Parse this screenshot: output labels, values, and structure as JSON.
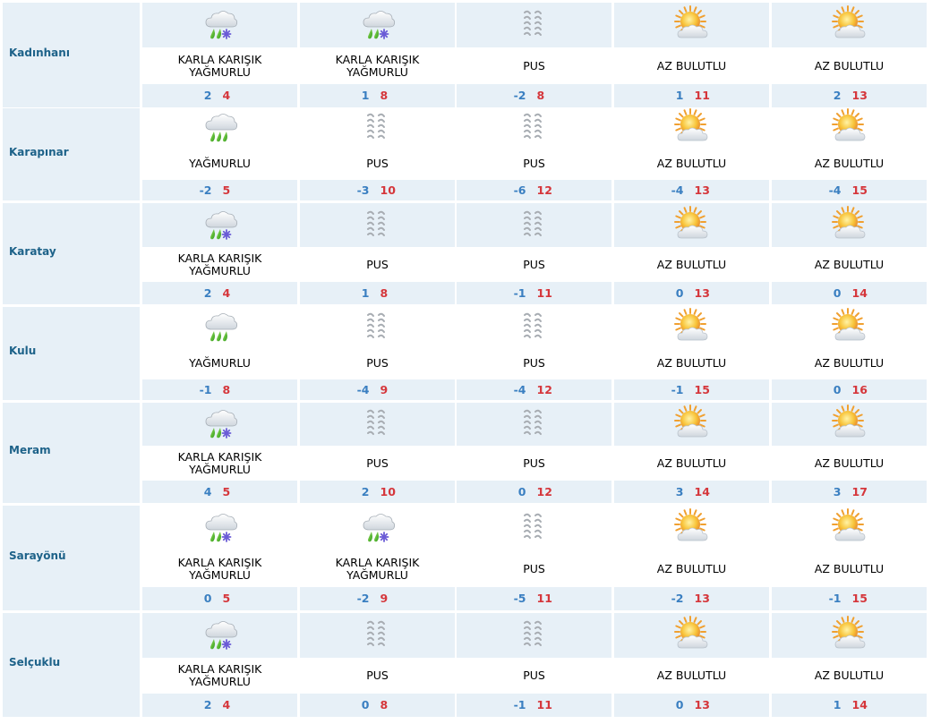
{
  "rows": [
    {
      "city": "Kadınhanı",
      "days": [
        {
          "icon": "sleet-icon",
          "desc": [
            "KARLA KARIŞIK",
            "YAĞMURLU"
          ],
          "min": "2",
          "max": "4"
        },
        {
          "icon": "sleet-icon",
          "desc": [
            "KARLA KARIŞIK",
            "YAĞMURLU"
          ],
          "min": "1",
          "max": "8"
        },
        {
          "icon": "fog-icon",
          "desc": [
            "PUS"
          ],
          "min": "-2",
          "max": "8"
        },
        {
          "icon": "partly-cloudy-icon",
          "desc": [
            "AZ BULUTLU"
          ],
          "min": "1",
          "max": "11"
        },
        {
          "icon": "partly-cloudy-icon",
          "desc": [
            "AZ BULUTLU"
          ],
          "min": "2",
          "max": "13"
        }
      ]
    },
    {
      "city": "Karapınar",
      "days": [
        {
          "icon": "rain-icon",
          "desc": [
            "YAĞMURLU"
          ],
          "min": "-2",
          "max": "5"
        },
        {
          "icon": "fog-icon",
          "desc": [
            "PUS"
          ],
          "min": "-3",
          "max": "10"
        },
        {
          "icon": "fog-icon",
          "desc": [
            "PUS"
          ],
          "min": "-6",
          "max": "12"
        },
        {
          "icon": "partly-cloudy-icon",
          "desc": [
            "AZ BULUTLU"
          ],
          "min": "-4",
          "max": "13"
        },
        {
          "icon": "partly-cloudy-icon",
          "desc": [
            "AZ BULUTLU"
          ],
          "min": "-4",
          "max": "15"
        }
      ]
    },
    {
      "city": "Karatay",
      "days": [
        {
          "icon": "sleet-icon",
          "desc": [
            "KARLA KARIŞIK",
            "YAĞMURLU"
          ],
          "min": "2",
          "max": "4"
        },
        {
          "icon": "fog-icon",
          "desc": [
            "PUS"
          ],
          "min": "1",
          "max": "8"
        },
        {
          "icon": "fog-icon",
          "desc": [
            "PUS"
          ],
          "min": "-1",
          "max": "11"
        },
        {
          "icon": "partly-cloudy-icon",
          "desc": [
            "AZ BULUTLU"
          ],
          "min": "0",
          "max": "13"
        },
        {
          "icon": "partly-cloudy-icon",
          "desc": [
            "AZ BULUTLU"
          ],
          "min": "0",
          "max": "14"
        }
      ]
    },
    {
      "city": "Kulu",
      "days": [
        {
          "icon": "rain-icon",
          "desc": [
            "YAĞMURLU"
          ],
          "min": "-1",
          "max": "8"
        },
        {
          "icon": "fog-icon",
          "desc": [
            "PUS"
          ],
          "min": "-4",
          "max": "9"
        },
        {
          "icon": "fog-icon",
          "desc": [
            "PUS"
          ],
          "min": "-4",
          "max": "12"
        },
        {
          "icon": "partly-cloudy-icon",
          "desc": [
            "AZ BULUTLU"
          ],
          "min": "-1",
          "max": "15"
        },
        {
          "icon": "partly-cloudy-icon",
          "desc": [
            "AZ BULUTLU"
          ],
          "min": "0",
          "max": "16"
        }
      ]
    },
    {
      "city": "Meram",
      "days": [
        {
          "icon": "sleet-icon",
          "desc": [
            "KARLA KARIŞIK",
            "YAĞMURLU"
          ],
          "min": "4",
          "max": "5"
        },
        {
          "icon": "fog-icon",
          "desc": [
            "PUS"
          ],
          "min": "2",
          "max": "10"
        },
        {
          "icon": "fog-icon",
          "desc": [
            "PUS"
          ],
          "min": "0",
          "max": "12"
        },
        {
          "icon": "partly-cloudy-icon",
          "desc": [
            "AZ BULUTLU"
          ],
          "min": "3",
          "max": "14"
        },
        {
          "icon": "partly-cloudy-icon",
          "desc": [
            "AZ BULUTLU"
          ],
          "min": "3",
          "max": "17"
        }
      ]
    },
    {
      "city": "Sarayönü",
      "days": [
        {
          "icon": "sleet-icon",
          "desc": [
            "KARLA KARIŞIK",
            "YAĞMURLU"
          ],
          "min": "0",
          "max": "5"
        },
        {
          "icon": "sleet-icon",
          "desc": [
            "KARLA KARIŞIK",
            "YAĞMURLU"
          ],
          "min": "-2",
          "max": "9"
        },
        {
          "icon": "fog-icon",
          "desc": [
            "PUS"
          ],
          "min": "-5",
          "max": "11"
        },
        {
          "icon": "partly-cloudy-icon",
          "desc": [
            "AZ BULUTLU"
          ],
          "min": "-2",
          "max": "13"
        },
        {
          "icon": "partly-cloudy-icon",
          "desc": [
            "AZ BULUTLU"
          ],
          "min": "-1",
          "max": "15"
        }
      ]
    },
    {
      "city": "Selçuklu",
      "days": [
        {
          "icon": "sleet-icon",
          "desc": [
            "KARLA KARIŞIK",
            "YAĞMURLU"
          ],
          "min": "2",
          "max": "4"
        },
        {
          "icon": "fog-icon",
          "desc": [
            "PUS"
          ],
          "min": "0",
          "max": "8"
        },
        {
          "icon": "fog-icon",
          "desc": [
            "PUS"
          ],
          "min": "-1",
          "max": "11"
        },
        {
          "icon": "partly-cloudy-icon",
          "desc": [
            "AZ BULUTLU"
          ],
          "min": "0",
          "max": "13"
        },
        {
          "icon": "partly-cloudy-icon",
          "desc": [
            "AZ BULUTLU"
          ],
          "min": "1",
          "max": "14"
        }
      ]
    }
  ],
  "colors": {
    "shaded_bg": "#e7f0f7",
    "city_text": "#1d6289",
    "min_temp": "#3a7fc1",
    "max_temp": "#d5363b"
  }
}
